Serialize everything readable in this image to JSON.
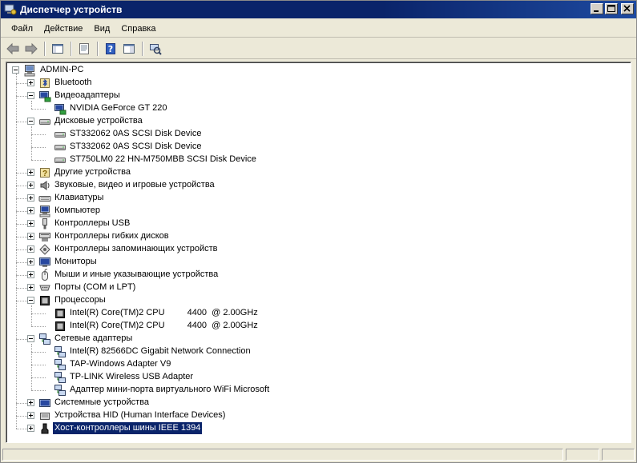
{
  "window": {
    "title": "Диспетчер устройств",
    "buttons": {
      "minimize": "_",
      "maximize": "□",
      "close": "✕"
    }
  },
  "menu": [
    "Файл",
    "Действие",
    "Вид",
    "Справка"
  ],
  "toolbar": {
    "buttons": [
      "back-icon",
      "forward-icon",
      "show-hide-tree-icon",
      "properties-icon",
      "help-icon",
      "console-tree-icon",
      "scan-hardware-icon"
    ]
  },
  "tree": {
    "root": "ADMIN-PC",
    "nodes": [
      {
        "label": "Bluetooth",
        "level": 1,
        "state": "collapsed",
        "icon": "bluetooth-icon"
      },
      {
        "label": "Видеоадаптеры",
        "level": 1,
        "state": "expanded",
        "icon": "display-adapter-icon"
      },
      {
        "label": "NVIDIA GeForce GT 220",
        "level": 2,
        "state": "leaf",
        "icon": "display-adapter-icon"
      },
      {
        "label": "Дисковые устройства",
        "level": 1,
        "state": "expanded",
        "icon": "disk-drive-icon"
      },
      {
        "label": "ST332062 0AS SCSI Disk Device",
        "level": 2,
        "state": "leaf",
        "icon": "disk-drive-icon"
      },
      {
        "label": "ST332062 0AS SCSI Disk Device",
        "level": 2,
        "state": "leaf",
        "icon": "disk-drive-icon"
      },
      {
        "label": "ST750LM0 22 HN-M750MBB SCSI Disk Device",
        "level": 2,
        "state": "leaf",
        "icon": "disk-drive-icon"
      },
      {
        "label": "Другие устройства",
        "level": 1,
        "state": "collapsed",
        "icon": "other-devices-icon"
      },
      {
        "label": "Звуковые, видео и игровые устройства",
        "level": 1,
        "state": "collapsed",
        "icon": "speaker-icon"
      },
      {
        "label": "Клавиатуры",
        "level": 1,
        "state": "collapsed",
        "icon": "keyboard-icon"
      },
      {
        "label": "Компьютер",
        "level": 1,
        "state": "collapsed",
        "icon": "computer-icon"
      },
      {
        "label": "Контроллеры USB",
        "level": 1,
        "state": "collapsed",
        "icon": "usb-icon"
      },
      {
        "label": "Контроллеры гибких дисков",
        "level": 1,
        "state": "collapsed",
        "icon": "floppy-controller-icon"
      },
      {
        "label": "Контроллеры запоминающих устройств",
        "level": 1,
        "state": "collapsed",
        "icon": "storage-controller-icon"
      },
      {
        "label": "Мониторы",
        "level": 1,
        "state": "collapsed",
        "icon": "monitor-icon"
      },
      {
        "label": "Мыши и иные указывающие устройства",
        "level": 1,
        "state": "collapsed",
        "icon": "mouse-icon"
      },
      {
        "label": "Порты (COM и LPT)",
        "level": 1,
        "state": "collapsed",
        "icon": "port-icon"
      },
      {
        "label": "Процессоры",
        "level": 1,
        "state": "expanded",
        "icon": "processor-icon"
      },
      {
        "label": "Intel(R) Core(TM)2 CPU",
        "suffix": "4400  @ 2.00GHz",
        "level": 2,
        "state": "leaf",
        "icon": "processor-icon"
      },
      {
        "label": "Intel(R) Core(TM)2 CPU",
        "suffix": "4400  @ 2.00GHz",
        "level": 2,
        "state": "leaf",
        "icon": "processor-icon"
      },
      {
        "label": "Сетевые адаптеры",
        "level": 1,
        "state": "expanded",
        "icon": "network-adapter-icon"
      },
      {
        "label": "Intel(R) 82566DC Gigabit Network Connection",
        "level": 2,
        "state": "leaf",
        "icon": "network-adapter-icon"
      },
      {
        "label": "TAP-Windows Adapter V9",
        "level": 2,
        "state": "leaf",
        "icon": "network-adapter-icon"
      },
      {
        "label": "TP-LINK Wireless USB Adapter",
        "level": 2,
        "state": "leaf",
        "icon": "network-adapter-icon"
      },
      {
        "label": "Адаптер мини-порта виртуального WiFi Microsoft",
        "level": 2,
        "state": "leaf",
        "icon": "network-adapter-icon"
      },
      {
        "label": "Системные устройства",
        "level": 1,
        "state": "collapsed",
        "icon": "system-devices-icon"
      },
      {
        "label": "Устройства HID (Human Interface Devices)",
        "level": 1,
        "state": "collapsed",
        "icon": "hid-icon"
      },
      {
        "label": "Хост-контроллеры шины IEEE 1394",
        "level": 1,
        "state": "collapsed",
        "icon": "ieee1394-icon",
        "selected": true
      }
    ]
  },
  "colors": {
    "selection": "#0a246a",
    "titlebar": "#0a246a",
    "window_bg": "#ece9d8"
  }
}
